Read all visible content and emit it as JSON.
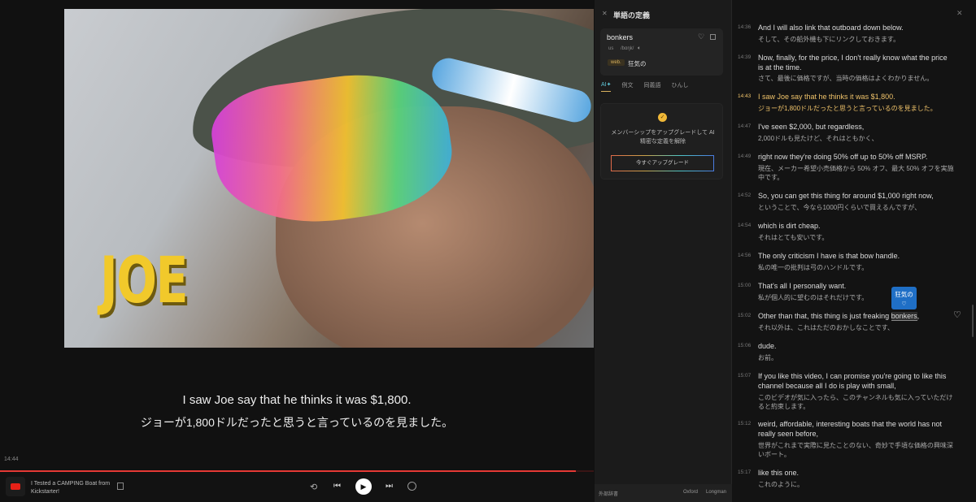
{
  "video": {
    "overlay_text": "JOE",
    "current_time": "14:44",
    "progress": 0.97,
    "subtitle_en": "I saw Joe say that he thinks it was $1,800.",
    "subtitle_jp": "ジョーが1,800ドルだったと思うと言っているのを見ました。"
  },
  "player": {
    "title": "I Tested a CAMPING Boat from Kickstarter!"
  },
  "definition": {
    "title": "単語の定義",
    "word": "bonkers",
    "region": "us",
    "phonetic": "/bɑŋk/",
    "pos": "web.",
    "meaning": "狂気の",
    "tabs": [
      "AI✦",
      "例文",
      "同義語",
      "ひんし"
    ],
    "upgrade_text": "メンバーシップをアップグレードして AI 精密な定義を解除",
    "upgrade_button": "今すぐアップグレード",
    "footer": {
      "external": "外部辞書",
      "oxford": "Oxford",
      "longman": "Longman"
    }
  },
  "transcript": [
    {
      "time": "14:36",
      "en": "And I will also link that outboard down below.",
      "jp": "そして、その船外機も下にリンクしておきます。"
    },
    {
      "time": "14:39",
      "en": "Now, finally, for the price, I don't really know what the price is at the time.",
      "jp": "さて、最後に価格ですが、当時の価格はよくわかりません。"
    },
    {
      "time": "14:43",
      "en": "I saw Joe say that he thinks it was $1,800.",
      "jp": "ジョーが1,800ドルだったと思うと言っているのを見ました。"
    },
    {
      "time": "14:47",
      "en": "I've seen $2,000, but regardless,",
      "jp": "2,000ドルも見たけど、それはともかく、"
    },
    {
      "time": "14:49",
      "en": "right now they're doing 50% off up to 50% off MSRP.",
      "jp": "現在、メーカー希望小売価格から 50% オフ、最大 50% オフを実施中です。"
    },
    {
      "time": "14:52",
      "en": "So, you can get this thing for around $1,000 right now,",
      "jp": "ということで、今なら1000円くらいで買えるんですが、"
    },
    {
      "time": "14:54",
      "en": "which is dirt cheap.",
      "jp": "それはとても安いです。"
    },
    {
      "time": "14:56",
      "en": "The only criticism I have is that bow handle.",
      "jp": "私の唯一の批判は弓のハンドルです。"
    },
    {
      "time": "15:00",
      "en": "That's all I personally want.",
      "jp": "私が個人的に望むのはそれだけです。"
    },
    {
      "time": "15:02",
      "en": "Other than that, this thing is just freaking",
      "word": "bonkers",
      "after": ",",
      "jp": "それ以外は、これはただのおかしなことです、"
    },
    {
      "time": "15:06",
      "en": "dude.",
      "jp": "お前。"
    },
    {
      "time": "15:07",
      "en": "If you like this video, I can promise you're going to like this channel because all I do is play with small,",
      "jp": "このビデオが気に入ったら、このチャンネルも気に入っていただけると約束します。"
    },
    {
      "time": "15:12",
      "en": "weird, affordable, interesting boats that the world has not really seen before,",
      "jp": "世界がこれまで実際に見たことのない、奇妙で手頃な価格の興味深いボート。"
    },
    {
      "time": "15:17",
      "en": "like this one.",
      "jp": "これのように。"
    }
  ],
  "tooltip": {
    "meaning": "狂気の"
  },
  "colors": {
    "accent": "#f0c36a",
    "progress": "#e53935",
    "tooltip": "#1f6fc6"
  }
}
